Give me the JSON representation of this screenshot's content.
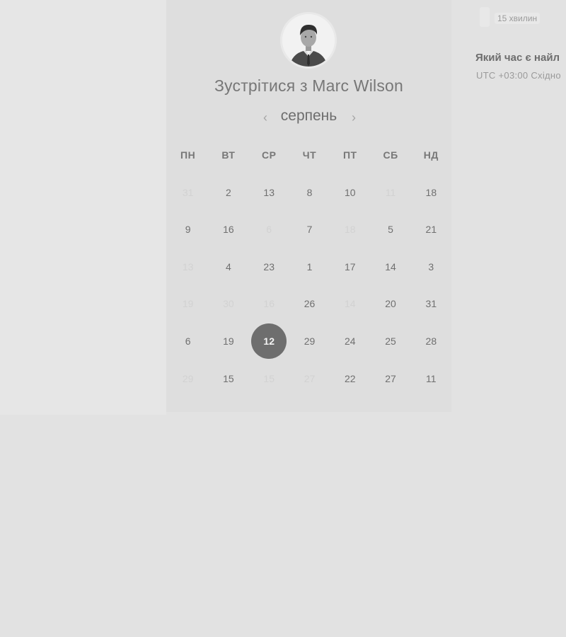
{
  "meeting": {
    "title": "Зустрітися з Marc Wilson"
  },
  "calendar": {
    "month": "серпень",
    "weekdays": [
      "ПН",
      "ВТ",
      "СР",
      "ЧТ",
      "ПТ",
      "СБ",
      "НД"
    ],
    "rows": [
      [
        {
          "d": "31",
          "muted": true
        },
        {
          "d": "2"
        },
        {
          "d": "13"
        },
        {
          "d": "8"
        },
        {
          "d": "10"
        },
        {
          "d": "11",
          "muted": true
        },
        {
          "d": "18"
        }
      ],
      [
        {
          "d": "9"
        },
        {
          "d": "16"
        },
        {
          "d": "6",
          "muted": true
        },
        {
          "d": "7"
        },
        {
          "d": "18",
          "muted": true
        },
        {
          "d": "5"
        },
        {
          "d": "21"
        }
      ],
      [
        {
          "d": "13",
          "muted": true
        },
        {
          "d": "4"
        },
        {
          "d": "23"
        },
        {
          "d": "1"
        },
        {
          "d": "17"
        },
        {
          "d": "14"
        },
        {
          "d": "3"
        }
      ],
      [
        {
          "d": "19",
          "muted": true
        },
        {
          "d": "30",
          "muted": true
        },
        {
          "d": "16",
          "muted": true
        },
        {
          "d": "26"
        },
        {
          "d": "14",
          "muted": true
        },
        {
          "d": "20"
        },
        {
          "d": "31"
        }
      ],
      [
        {
          "d": "6"
        },
        {
          "d": "19"
        },
        {
          "d": "12",
          "selected": true
        },
        {
          "d": "29"
        },
        {
          "d": "24"
        },
        {
          "d": "25"
        },
        {
          "d": "28"
        }
      ],
      [
        {
          "d": "29",
          "muted": true
        },
        {
          "d": "15"
        },
        {
          "d": "15",
          "muted": true
        },
        {
          "d": "27",
          "muted": true
        },
        {
          "d": "22"
        },
        {
          "d": "27"
        },
        {
          "d": "11"
        }
      ]
    ]
  },
  "booking": {
    "duration": "15 хвилин",
    "question": "Який час є найл",
    "timezone": "UTC +03:00 Східно"
  },
  "icons": {
    "prev": "chevron-left-icon",
    "next": "chevron-right-icon",
    "avatar": "user-avatar"
  }
}
